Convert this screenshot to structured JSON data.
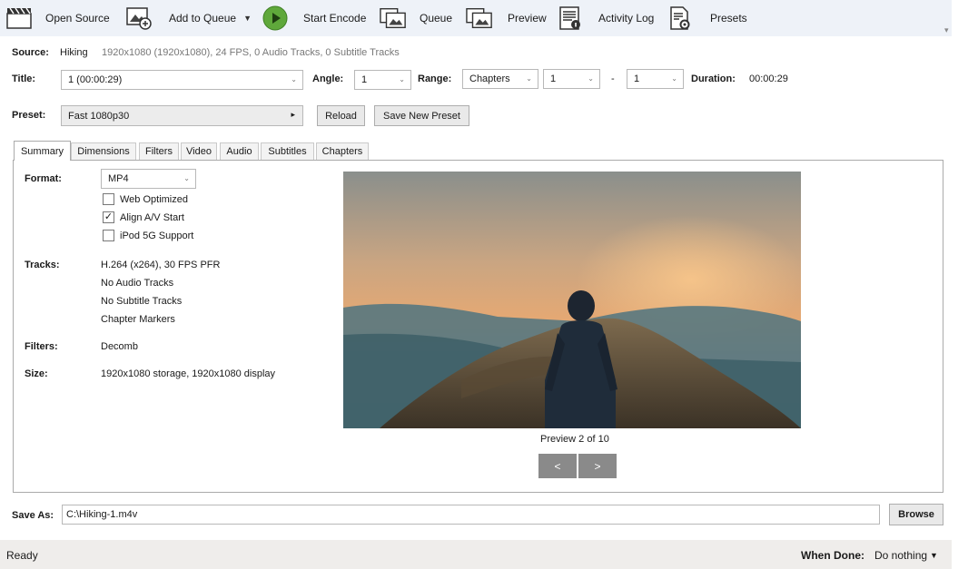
{
  "toolbar": {
    "open_source": "Open Source",
    "add_to_queue": "Add to Queue",
    "start_encode": "Start Encode",
    "queue": "Queue",
    "preview": "Preview",
    "activity_log": "Activity Log",
    "presets": "Presets"
  },
  "source": {
    "label": "Source:",
    "name": "Hiking",
    "info": "1920x1080 (1920x1080), 24 FPS, 0 Audio Tracks, 0 Subtitle Tracks"
  },
  "title_row": {
    "title_label": "Title:",
    "title_value": "1 (00:00:29)",
    "angle_label": "Angle:",
    "angle_value": "1",
    "range_label": "Range:",
    "range_type": "Chapters",
    "range_start": "1",
    "range_sep": "-",
    "range_end": "1",
    "duration_label": "Duration:",
    "duration_value": "00:00:29"
  },
  "preset_row": {
    "label": "Preset:",
    "value": "Fast 1080p30",
    "reload": "Reload",
    "save_new": "Save New Preset"
  },
  "tabs": [
    "Summary",
    "Dimensions",
    "Filters",
    "Video",
    "Audio",
    "Subtitles",
    "Chapters"
  ],
  "summary": {
    "format_label": "Format:",
    "format_value": "MP4",
    "web_optimized": "Web Optimized",
    "web_optimized_checked": false,
    "align_av": "Align A/V Start",
    "align_av_checked": true,
    "ipod": "iPod 5G Support",
    "ipod_checked": false,
    "tracks_label": "Tracks:",
    "tracks": [
      "H.264 (x264), 30 FPS PFR",
      "No Audio Tracks",
      "No Subtitle Tracks",
      "Chapter Markers"
    ],
    "filters_label": "Filters:",
    "filters_value": "Decomb",
    "size_label": "Size:",
    "size_value": "1920x1080 storage, 1920x1080 display",
    "preview_caption": "Preview 2 of 10",
    "prev_btn": "<",
    "next_btn": ">"
  },
  "save_as": {
    "label": "Save As:",
    "value": "C:\\Hiking-1.m4v",
    "browse": "Browse"
  },
  "status": {
    "text": "Ready",
    "when_done_label": "When Done:",
    "when_done_value": "Do nothing"
  },
  "colors": {
    "toolbar_bg": "#eef2f8",
    "start_green": "#5fa83b",
    "status_bg": "#efedeb"
  }
}
